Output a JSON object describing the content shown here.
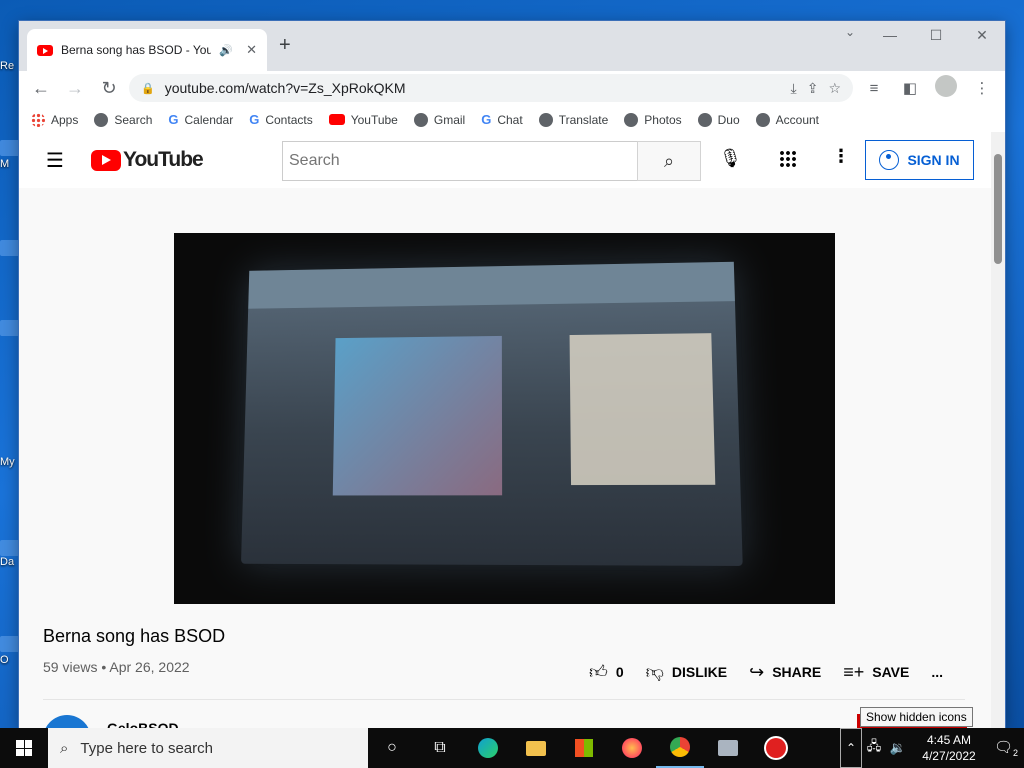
{
  "desktop": {
    "labels": [
      "Re",
      "M",
      "My",
      "Da",
      "O"
    ]
  },
  "browser": {
    "tab_title": "Berna song has BSOD - YouT",
    "tab_audio_icon": "speaker-icon",
    "url": "youtube.com/watch?v=Zs_XpRokQKM",
    "bookmarks": [
      "Apps",
      "Search",
      "Calendar",
      "Contacts",
      "YouTube",
      "Gmail",
      "Chat",
      "Translate",
      "Photos",
      "Duo",
      "Account"
    ]
  },
  "youtube": {
    "logo_text": "YouTube",
    "search_placeholder": "Search",
    "sign_in_label": "SIGN IN",
    "video_title": "Berna song has BSOD",
    "video_meta": "59 views • Apr 26, 2022",
    "like_count": "0",
    "dislike_label": "DISLIKE",
    "share_label": "SHARE",
    "save_label": "SAVE",
    "more_label": "...",
    "channel_name": "GeloBSOD"
  },
  "tooltip": "Show hidden icons",
  "taskbar": {
    "search_placeholder": "Type here to search",
    "time": "4:45 AM",
    "date": "4/27/2022",
    "notification_count": "2"
  },
  "colors": {
    "youtube_red": "#ff0000",
    "link_blue": "#065fd4",
    "desktop_blue": "#1565c0"
  }
}
